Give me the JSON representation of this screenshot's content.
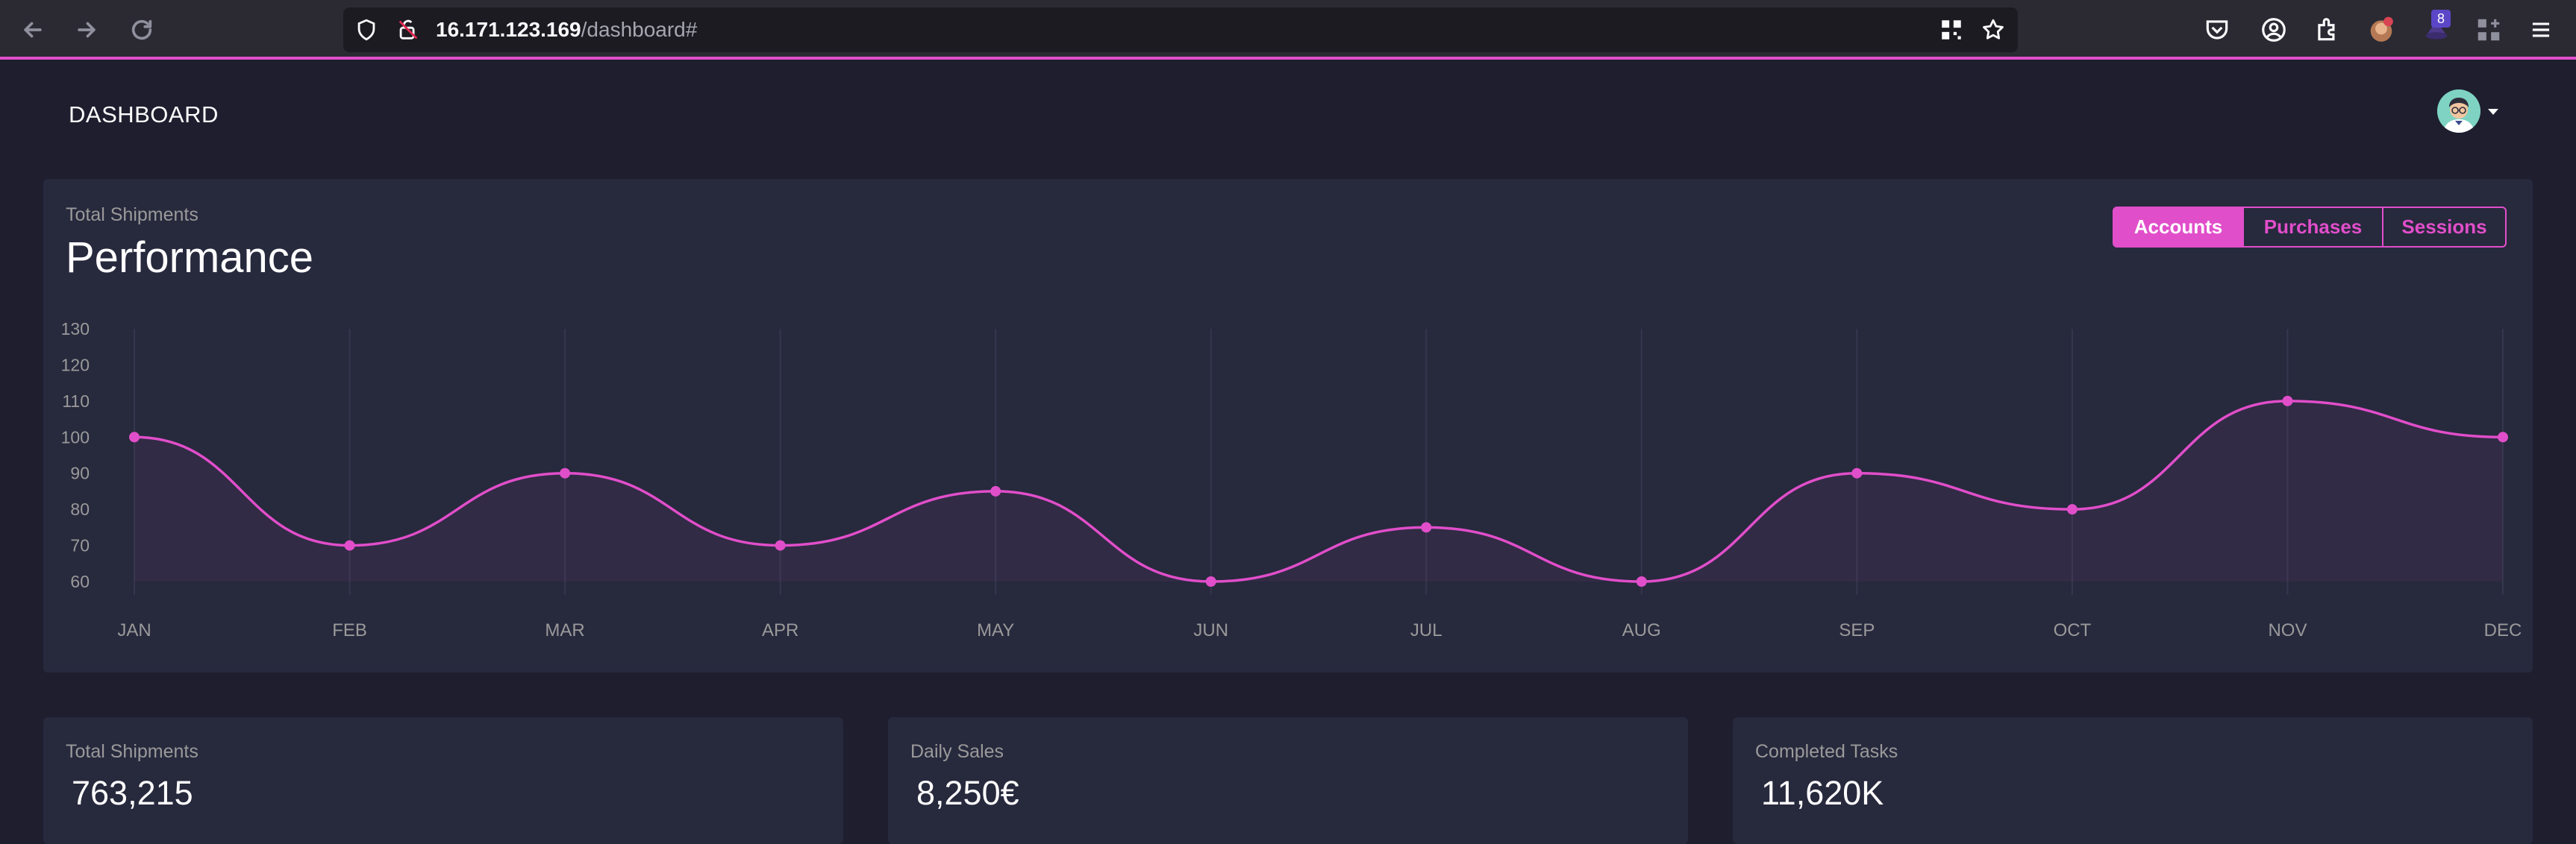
{
  "browser": {
    "url_host": "16.171.123.169",
    "url_path": "/dashboard#",
    "extension_badge": "8",
    "icons": [
      "back-arrow-icon",
      "forward-arrow-icon",
      "reload-icon",
      "shield-icon",
      "lock-warning-icon",
      "qr-code-icon",
      "bookmark-star-icon",
      "pocket-icon",
      "account-icon",
      "extensions-icon",
      "avatar-extension-icon",
      "hat-extension-icon",
      "grid-plus-icon",
      "hamburger-menu-icon"
    ]
  },
  "header": {
    "title": "DASHBOARD"
  },
  "performance": {
    "subtitle": "Total Shipments",
    "title": "Performance",
    "tabs": [
      {
        "label": "Accounts",
        "active": true
      },
      {
        "label": "Purchases",
        "active": false
      },
      {
        "label": "Sessions",
        "active": false
      }
    ]
  },
  "chart_data": {
    "type": "line",
    "title": "Performance",
    "categories": [
      "JAN",
      "FEB",
      "MAR",
      "APR",
      "MAY",
      "JUN",
      "JUL",
      "AUG",
      "SEP",
      "OCT",
      "NOV",
      "DEC"
    ],
    "series": [
      {
        "values": [
          100,
          70,
          90,
          70,
          85,
          60,
          75,
          60,
          90,
          80,
          110,
          100
        ]
      }
    ],
    "yticks": [
      60,
      70,
      80,
      90,
      100,
      110,
      120,
      130
    ],
    "ylim": [
      60,
      130
    ],
    "grid": "vertical",
    "curve": "smooth",
    "colors": {
      "line": "#e14eca",
      "grid": "#34374d",
      "tick": "#9a9a9a"
    }
  },
  "stats": [
    {
      "label": "Total Shipments",
      "value": "763,215"
    },
    {
      "label": "Daily Sales",
      "value": "8,250€"
    },
    {
      "label": "Completed Tasks",
      "value": "11,620K"
    }
  ],
  "colors": {
    "accent": "#e14eca",
    "background": "#1e1e2f",
    "card": "#27293d"
  }
}
